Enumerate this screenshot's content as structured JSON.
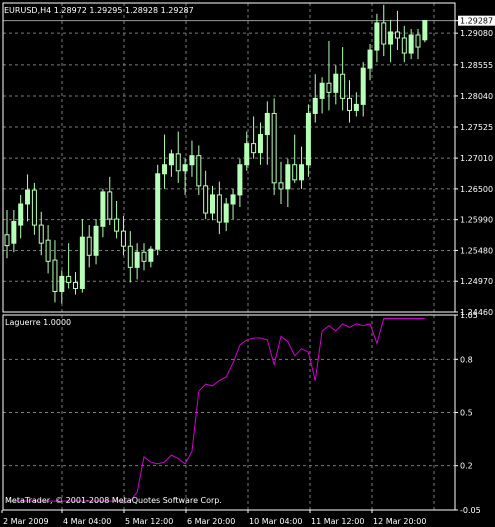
{
  "window_title": "EURUSD,H4 1.28972 1.29295 1.28928 1.29287",
  "indicator_title": "Laguerre 1.0000",
  "copyright": "MetaTrader, © 2001-2008 MetaQuotes Software Corp.",
  "colors": {
    "background": "#000000",
    "grid": "#7a7a7a",
    "bull_candle": "#b6ffb6",
    "bear_candle": "#000000",
    "wick": "#b6ffb6",
    "indicator_line": "#d000d0",
    "axis": "#ffffff",
    "current_price_label_bg": "#ffffff",
    "current_price_label_text": "#000000"
  },
  "price_axis": [
    "1.29287",
    "1.29080",
    "1.28555",
    "1.28040",
    "1.27525",
    "1.27010",
    "1.26500",
    "1.25990",
    "1.25480",
    "1.24970",
    "1.24460"
  ],
  "current_price": "1.29287",
  "indicator_axis": [
    "1.05",
    "0.8",
    "0.5",
    "0.2",
    "-0.05"
  ],
  "time_axis": [
    "2 Mar 2009",
    "4 Mar 04:00",
    "5 Mar 12:00",
    "6 Mar 20:00",
    "10 Mar 04:00",
    "11 Mar 12:00",
    "12 Mar 20:00"
  ],
  "chart_data": {
    "type": "candlestick",
    "symbol": "EURUSD",
    "timeframe": "H4",
    "ylim": [
      1.2446,
      1.2958
    ],
    "candles": [
      {
        "o": 1.2574,
        "h": 1.2615,
        "l": 1.2535,
        "c": 1.2556
      },
      {
        "o": 1.256,
        "h": 1.2615,
        "l": 1.2545,
        "c": 1.2596
      },
      {
        "o": 1.259,
        "h": 1.264,
        "l": 1.2568,
        "c": 1.2625
      },
      {
        "o": 1.2625,
        "h": 1.2674,
        "l": 1.2596,
        "c": 1.2648
      },
      {
        "o": 1.2648,
        "h": 1.266,
        "l": 1.2574,
        "c": 1.259
      },
      {
        "o": 1.259,
        "h": 1.2612,
        "l": 1.254,
        "c": 1.256
      },
      {
        "o": 1.2565,
        "h": 1.259,
        "l": 1.251,
        "c": 1.253
      },
      {
        "o": 1.2532,
        "h": 1.2565,
        "l": 1.2462,
        "c": 1.248
      },
      {
        "o": 1.248,
        "h": 1.2515,
        "l": 1.246,
        "c": 1.2505
      },
      {
        "o": 1.2505,
        "h": 1.256,
        "l": 1.2485,
        "c": 1.2495
      },
      {
        "o": 1.2495,
        "h": 1.2512,
        "l": 1.2475,
        "c": 1.2485
      },
      {
        "o": 1.2485,
        "h": 1.26,
        "l": 1.2478,
        "c": 1.257
      },
      {
        "o": 1.257,
        "h": 1.259,
        "l": 1.252,
        "c": 1.254
      },
      {
        "o": 1.254,
        "h": 1.26,
        "l": 1.2525,
        "c": 1.2588
      },
      {
        "o": 1.2588,
        "h": 1.265,
        "l": 1.257,
        "c": 1.2645
      },
      {
        "o": 1.2645,
        "h": 1.267,
        "l": 1.259,
        "c": 1.26
      },
      {
        "o": 1.26,
        "h": 1.263,
        "l": 1.2568,
        "c": 1.258
      },
      {
        "o": 1.258,
        "h": 1.2605,
        "l": 1.254,
        "c": 1.2555
      },
      {
        "o": 1.2555,
        "h": 1.258,
        "l": 1.2495,
        "c": 1.252
      },
      {
        "o": 1.252,
        "h": 1.256,
        "l": 1.25,
        "c": 1.2545
      },
      {
        "o": 1.2545,
        "h": 1.256,
        "l": 1.2515,
        "c": 1.253
      },
      {
        "o": 1.253,
        "h": 1.2555,
        "l": 1.252,
        "c": 1.255
      },
      {
        "o": 1.255,
        "h": 1.269,
        "l": 1.254,
        "c": 1.2675
      },
      {
        "o": 1.2675,
        "h": 1.274,
        "l": 1.265,
        "c": 1.269
      },
      {
        "o": 1.269,
        "h": 1.2715,
        "l": 1.267,
        "c": 1.2708
      },
      {
        "o": 1.2708,
        "h": 1.2745,
        "l": 1.266,
        "c": 1.268
      },
      {
        "o": 1.268,
        "h": 1.27,
        "l": 1.264,
        "c": 1.269
      },
      {
        "o": 1.269,
        "h": 1.273,
        "l": 1.267,
        "c": 1.2705
      },
      {
        "o": 1.2705,
        "h": 1.2722,
        "l": 1.264,
        "c": 1.2655
      },
      {
        "o": 1.2655,
        "h": 1.268,
        "l": 1.26,
        "c": 1.261
      },
      {
        "o": 1.261,
        "h": 1.2655,
        "l": 1.2598,
        "c": 1.264
      },
      {
        "o": 1.264,
        "h": 1.2662,
        "l": 1.2575,
        "c": 1.2595
      },
      {
        "o": 1.2595,
        "h": 1.2635,
        "l": 1.258,
        "c": 1.2625
      },
      {
        "o": 1.2625,
        "h": 1.265,
        "l": 1.26,
        "c": 1.264
      },
      {
        "o": 1.264,
        "h": 1.27,
        "l": 1.262,
        "c": 1.269
      },
      {
        "o": 1.269,
        "h": 1.2745,
        "l": 1.268,
        "c": 1.2725
      },
      {
        "o": 1.2725,
        "h": 1.277,
        "l": 1.27,
        "c": 1.271
      },
      {
        "o": 1.271,
        "h": 1.276,
        "l": 1.269,
        "c": 1.274
      },
      {
        "o": 1.274,
        "h": 1.2795,
        "l": 1.269,
        "c": 1.2775
      },
      {
        "o": 1.2775,
        "h": 1.28,
        "l": 1.264,
        "c": 1.266
      },
      {
        "o": 1.266,
        "h": 1.2695,
        "l": 1.2625,
        "c": 1.265
      },
      {
        "o": 1.265,
        "h": 1.27,
        "l": 1.262,
        "c": 1.269
      },
      {
        "o": 1.269,
        "h": 1.274,
        "l": 1.266,
        "c": 1.2665
      },
      {
        "o": 1.2665,
        "h": 1.272,
        "l": 1.265,
        "c": 1.269
      },
      {
        "o": 1.269,
        "h": 1.279,
        "l": 1.267,
        "c": 1.2775
      },
      {
        "o": 1.2775,
        "h": 1.284,
        "l": 1.276,
        "c": 1.28
      },
      {
        "o": 1.28,
        "h": 1.2835,
        "l": 1.2775,
        "c": 1.2825
      },
      {
        "o": 1.2825,
        "h": 1.2895,
        "l": 1.278,
        "c": 1.281
      },
      {
        "o": 1.281,
        "h": 1.2855,
        "l": 1.279,
        "c": 1.284
      },
      {
        "o": 1.284,
        "h": 1.2885,
        "l": 1.278,
        "c": 1.28
      },
      {
        "o": 1.28,
        "h": 1.283,
        "l": 1.276,
        "c": 1.278
      },
      {
        "o": 1.278,
        "h": 1.281,
        "l": 1.277,
        "c": 1.279
      },
      {
        "o": 1.279,
        "h": 1.286,
        "l": 1.277,
        "c": 1.285
      },
      {
        "o": 1.285,
        "h": 1.289,
        "l": 1.283,
        "c": 1.288
      },
      {
        "o": 1.288,
        "h": 1.294,
        "l": 1.286,
        "c": 1.2925
      },
      {
        "o": 1.2925,
        "h": 1.2955,
        "l": 1.287,
        "c": 1.289
      },
      {
        "o": 1.289,
        "h": 1.293,
        "l": 1.286,
        "c": 1.291
      },
      {
        "o": 1.291,
        "h": 1.2945,
        "l": 1.288,
        "c": 1.29
      },
      {
        "o": 1.29,
        "h": 1.292,
        "l": 1.286,
        "c": 1.2875
      },
      {
        "o": 1.2875,
        "h": 1.2915,
        "l": 1.2865,
        "c": 1.2905
      },
      {
        "o": 1.2905,
        "h": 1.2915,
        "l": 1.2865,
        "c": 1.2885
      },
      {
        "o": 1.2897,
        "h": 1.293,
        "l": 1.2893,
        "c": 1.2929
      }
    ],
    "indicator": {
      "name": "Laguerre 1.0000",
      "ylim": [
        -0.05,
        1.05
      ],
      "values": [
        0,
        0,
        0,
        0,
        0,
        0,
        0,
        0,
        0,
        0,
        0,
        0,
        0,
        0,
        0,
        0,
        0,
        0,
        0,
        0.05,
        0.25,
        0.22,
        0.21,
        0.22,
        0.26,
        0.24,
        0.21,
        0.28,
        0.62,
        0.66,
        0.65,
        0.68,
        0.7,
        0.78,
        0.88,
        0.91,
        0.92,
        0.92,
        0.91,
        0.77,
        0.93,
        0.9,
        0.82,
        0.86,
        0.84,
        0.68,
        0.96,
        0.99,
        0.96,
        1.0,
        0.98,
        1.0,
        0.99,
        1.0,
        0.89,
        1.03,
        1.03,
        1.03,
        1.03,
        1.03,
        1.03,
        1.03
      ]
    }
  }
}
